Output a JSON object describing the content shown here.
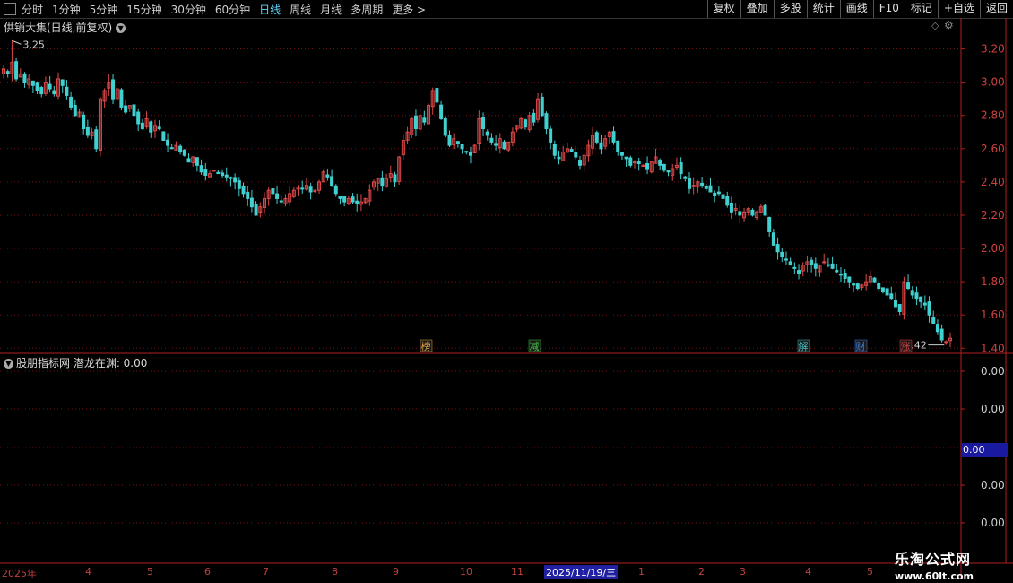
{
  "toolbar": {
    "periods": [
      "分时",
      "1分钟",
      "5分钟",
      "15分钟",
      "30分钟",
      "60分钟",
      "日线",
      "周线",
      "月线",
      "多周期",
      "更多 >"
    ],
    "active_period": "日线",
    "buttons": [
      "复权",
      "叠加",
      "多股",
      "统计",
      "画线",
      "F10",
      "标记",
      "+自选",
      "返回"
    ]
  },
  "main_panel": {
    "title": "供销大集(日线,前复权)",
    "high_label": "3.25",
    "low_label": "1.42",
    "y_ticks": [
      "3.20",
      "3.00",
      "2.80",
      "2.60",
      "2.40",
      "2.20",
      "2.00",
      "1.80",
      "1.60",
      "1.40"
    ],
    "markers": [
      {
        "text": "榜",
        "color": "#e0a040"
      },
      {
        "text": "减",
        "color": "#40c040"
      },
      {
        "text": "解",
        "color": "#40c0c0"
      },
      {
        "text": "财",
        "color": "#4080e0"
      },
      {
        "text": "涨",
        "color": "#e04040"
      }
    ],
    "colors": {
      "up": "#e04848",
      "down": "#40d0d0",
      "grid": "#7a1010",
      "axis": "#b02020"
    }
  },
  "sub_panel": {
    "title": "股朋指标网 潜龙在渊: 0.00",
    "y_ticks": [
      "0.00",
      "0.00",
      "0.00",
      "0.00",
      "0.00"
    ],
    "cursor_value": "0.00"
  },
  "date_axis": {
    "labels": [
      "2025年",
      "4",
      "5",
      "6",
      "7",
      "8",
      "9",
      "10",
      "11",
      "1",
      "2",
      "3",
      "4",
      "5"
    ],
    "cursor_date": "2025/11/19/三"
  },
  "watermark": {
    "line1": "乐淘公式网",
    "line2": "www.60lt.com"
  },
  "chart_data": {
    "type": "candlestick",
    "ylim": [
      1.38,
      3.3
    ],
    "price_ticks": [
      3.2,
      3.0,
      2.8,
      2.6,
      2.4,
      2.2,
      2.0,
      1.8,
      1.6,
      1.4
    ],
    "close": [
      3.08,
      3.05,
      3.12,
      3.02,
      3.05,
      3.0,
      3.02,
      2.98,
      2.95,
      2.93,
      3.0,
      2.96,
      2.93,
      3.02,
      2.98,
      2.92,
      2.85,
      2.8,
      2.82,
      2.72,
      2.68,
      2.7,
      2.6,
      2.9,
      2.95,
      3.0,
      2.9,
      2.96,
      2.85,
      2.82,
      2.86,
      2.8,
      2.75,
      2.72,
      2.78,
      2.7,
      2.74,
      2.72,
      2.65,
      2.62,
      2.6,
      2.62,
      2.58,
      2.56,
      2.52,
      2.55,
      2.5,
      2.46,
      2.44,
      2.45,
      2.47,
      2.45,
      2.44,
      2.43,
      2.42,
      2.4,
      2.36,
      2.33,
      2.3,
      2.25,
      2.2,
      2.25,
      2.3,
      2.35,
      2.33,
      2.3,
      2.28,
      2.3,
      2.33,
      2.35,
      2.37,
      2.36,
      2.38,
      2.34,
      2.35,
      2.4,
      2.46,
      2.43,
      2.38,
      2.33,
      2.3,
      2.28,
      2.3,
      2.28,
      2.27,
      2.28,
      2.3,
      2.35,
      2.4,
      2.42,
      2.38,
      2.42,
      2.45,
      2.4,
      2.55,
      2.65,
      2.7,
      2.78,
      2.72,
      2.8,
      2.76,
      2.86,
      2.95,
      2.88,
      2.78,
      2.68,
      2.62,
      2.66,
      2.63,
      2.6,
      2.58,
      2.56,
      2.62,
      2.78,
      2.72,
      2.68,
      2.64,
      2.62,
      2.66,
      2.6,
      2.64,
      2.7,
      2.74,
      2.78,
      2.73,
      2.8,
      2.76,
      2.9,
      2.8,
      2.72,
      2.64,
      2.56,
      2.54,
      2.58,
      2.6,
      2.58,
      2.55,
      2.5,
      2.56,
      2.62,
      2.68,
      2.64,
      2.6,
      2.66,
      2.7,
      2.64,
      2.58,
      2.56,
      2.54,
      2.5,
      2.52,
      2.51,
      2.5,
      2.48,
      2.52,
      2.55,
      2.5,
      2.47,
      2.46,
      2.48,
      2.5,
      2.45,
      2.42,
      2.36,
      2.38,
      2.4,
      2.38,
      2.36,
      2.34,
      2.32,
      2.33,
      2.3,
      2.26,
      2.22,
      2.24,
      2.2,
      2.22,
      2.24,
      2.2,
      2.22,
      2.25,
      2.2,
      2.1,
      2.02,
      1.98,
      1.95,
      1.93,
      1.9,
      1.88,
      1.85,
      1.9,
      1.92,
      1.9,
      1.88,
      1.9,
      1.92,
      1.9,
      1.88,
      1.86,
      1.84,
      1.82,
      1.8,
      1.78,
      1.76,
      1.78,
      1.8,
      1.83,
      1.8,
      1.76,
      1.74,
      1.72,
      1.7,
      1.65,
      1.62,
      1.8,
      1.76,
      1.72,
      1.7,
      1.68,
      1.66,
      1.6,
      1.55,
      1.5,
      1.45,
      1.44,
      1.46
    ],
    "high_point": 3.25,
    "low_point": 1.42
  }
}
